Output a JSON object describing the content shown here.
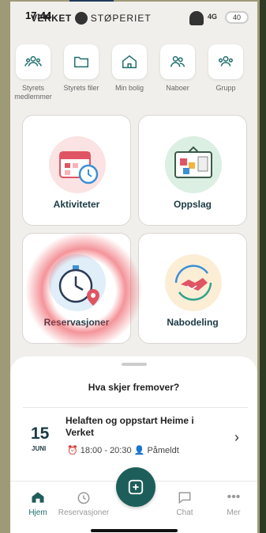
{
  "status": {
    "time": "17:44",
    "signal": "4G",
    "battery": "40"
  },
  "header": {
    "brand_name": "VERKET",
    "brand_sub": "STØPERIET"
  },
  "quick_links": [
    {
      "label": "Styrets medlemmer",
      "icon": "people-icon"
    },
    {
      "label": "Styrets filer",
      "icon": "folder-icon"
    },
    {
      "label": "Min bolig",
      "icon": "home-icon"
    },
    {
      "label": "Naboer",
      "icon": "neighbors-icon"
    },
    {
      "label": "Grupp",
      "icon": "group-icon"
    }
  ],
  "cards": [
    {
      "label": "Aktiviteter",
      "icon": "calendar-illustration"
    },
    {
      "label": "Oppslag",
      "icon": "board-illustration"
    },
    {
      "label": "Reservasjoner",
      "icon": "stopwatch-illustration"
    },
    {
      "label": "Nabodeling",
      "icon": "handshake-illustration"
    }
  ],
  "upcoming": {
    "title": "Hva skjer fremover?",
    "event": {
      "day": "15",
      "month": "JUNI",
      "title": "Helaften og oppstart Heime i Verket",
      "time": "18:00 - 20:30",
      "status": "Påmeldt"
    }
  },
  "tabs": [
    {
      "label": "Hjem",
      "icon": "home-icon",
      "active": true
    },
    {
      "label": "Reservasjoner",
      "icon": "clock-icon",
      "active": false
    },
    {
      "label": "Chat",
      "icon": "chat-icon",
      "active": false
    },
    {
      "label": "Mer",
      "icon": "more-icon",
      "active": false
    }
  ],
  "colors": {
    "accent": "#1e5e5a",
    "text_dark": "#1c3a44",
    "annotation_red": "#eb3c46"
  }
}
